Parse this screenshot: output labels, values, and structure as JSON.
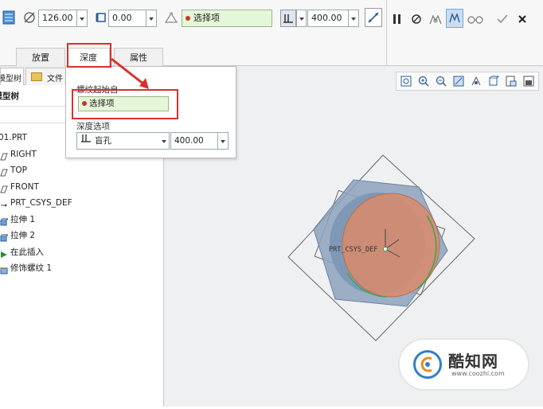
{
  "ribbon": {
    "diameter_value": "126.00",
    "pitch_value": "0.00",
    "placement_ref_label": "选择项",
    "depth_value": "400.00"
  },
  "tabs": [
    {
      "label": "放置"
    },
    {
      "label": "深度"
    },
    {
      "label": "属性"
    }
  ],
  "panel_tabs": [
    {
      "label": "模型树"
    },
    {
      "label": "文件"
    }
  ],
  "panel": {
    "title": "模型树"
  },
  "tree": [
    {
      "label": "01.PRT"
    },
    {
      "label": "RIGHT"
    },
    {
      "label": "TOP"
    },
    {
      "label": "FRONT"
    },
    {
      "label": "PRT_CSYS_DEF"
    },
    {
      "label": "拉伸 1"
    },
    {
      "label": "拉伸 2"
    },
    {
      "label": "在此插入"
    },
    {
      "label": "修饰螺纹 1"
    }
  ],
  "popup": {
    "section_title": "螺纹起始自",
    "select_label": "选择项",
    "depth_title": "深度选项",
    "depth_option": "盲孔",
    "depth_value": "400.00"
  },
  "canvas": {
    "csys_label": "PRT_CSYS_DEF"
  },
  "watermark": {
    "brand": "酷知网",
    "url": "www.coozhi.com"
  },
  "colors": {
    "accent_red": "#d9302c",
    "select_green": "#e6f6d8",
    "model_fill": "#8ca2bd",
    "thread_fill": "#d98a6a"
  }
}
